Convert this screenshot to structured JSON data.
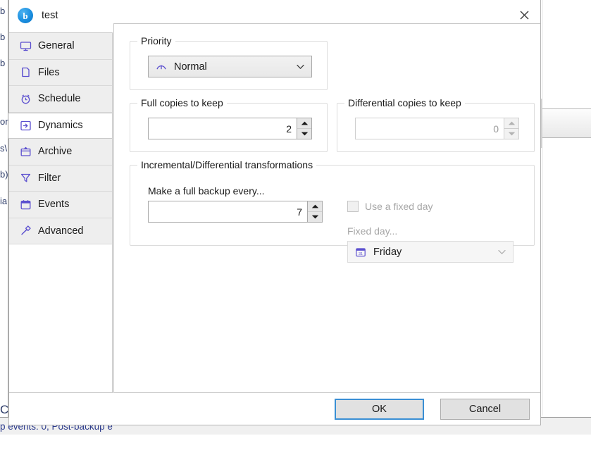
{
  "background": {
    "fragments": [
      "b",
      "b",
      "b",
      "on",
      "s\\",
      "b)",
      "ia"
    ],
    "status_text": "p events: 0, Post-backup e",
    "left_char": "C"
  },
  "dialog": {
    "title": "test",
    "icon": "backup-app-icon",
    "icon_letter": "b",
    "close_icon": "close-icon"
  },
  "sidebar": {
    "items": [
      {
        "label": "General",
        "icon": "monitor-icon",
        "selected": false
      },
      {
        "label": "Files",
        "icon": "file-icon",
        "selected": false
      },
      {
        "label": "Schedule",
        "icon": "alarm-icon",
        "selected": false
      },
      {
        "label": "Dynamics",
        "icon": "dynamics-icon",
        "selected": true
      },
      {
        "label": "Archive",
        "icon": "archive-icon",
        "selected": false
      },
      {
        "label": "Filter",
        "icon": "funnel-icon",
        "selected": false
      },
      {
        "label": "Events",
        "icon": "calendar-icon",
        "selected": false
      },
      {
        "label": "Advanced",
        "icon": "hammer-icon",
        "selected": false
      }
    ]
  },
  "content": {
    "priority": {
      "group_label": "Priority",
      "value": "Normal",
      "icon": "gauge-icon"
    },
    "full_copies": {
      "group_label": "Full copies to keep",
      "value": "2"
    },
    "differential_copies": {
      "group_label": "Differential copies to keep",
      "value": "0"
    },
    "transformations": {
      "group_label": "Incremental/Differential transformations",
      "full_backup_label": "Make a full backup every...",
      "full_backup_value": "7",
      "use_fixed_day_label": "Use a fixed day",
      "use_fixed_day_checked": false,
      "fixed_day_label": "Fixed day...",
      "fixed_day_value": "Friday",
      "fixed_day_icon": "calendar-icon"
    }
  },
  "footer": {
    "ok_label": "OK",
    "cancel_label": "Cancel"
  },
  "colors": {
    "accent_icon": "#5b4fcf",
    "focus_border": "#3a8fd4",
    "status_text": "#2b3a8c"
  }
}
